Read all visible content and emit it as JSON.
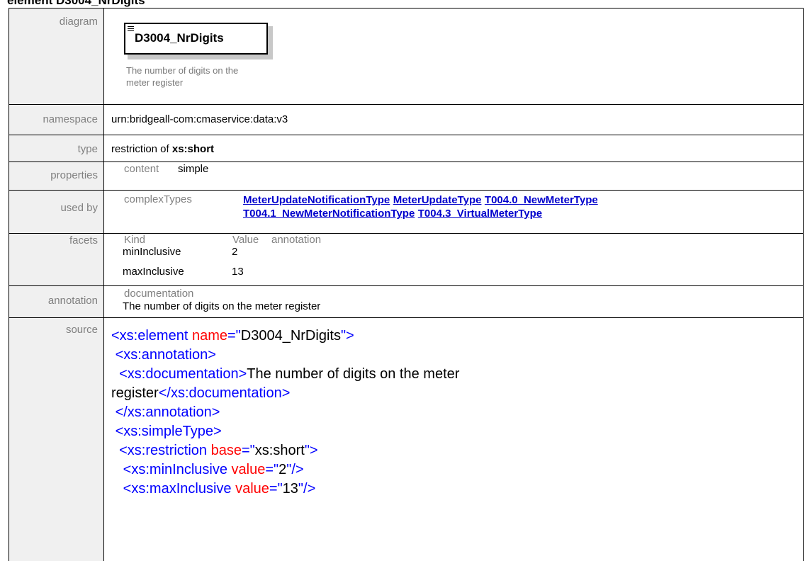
{
  "heading": "element D3004_NrDigits",
  "labels": {
    "diagram": "diagram",
    "namespace": "namespace",
    "type": "type",
    "properties": "properties",
    "used_by": "used by",
    "facets": "facets",
    "annotation": "annotation",
    "source": "source"
  },
  "diagram": {
    "element_name": "D3004_NrDigits",
    "doc_line1": "The number of digits on the",
    "doc_line2": "meter register"
  },
  "namespace": "urn:bridgeall-com:cmaservice:data:v3",
  "type": {
    "prefix": "restriction of ",
    "base": "xs:short"
  },
  "properties": {
    "key": "content",
    "value": "simple"
  },
  "used_by": {
    "category": "complexTypes",
    "links": [
      "MeterUpdateNotificationType",
      "MeterUpdateType",
      "T004.0_NewMeterType",
      "T004.1_NewMeterNotificationType",
      "T004.3_VirtualMeterType"
    ]
  },
  "facets": {
    "headers": [
      "Kind",
      "Value",
      "annotation"
    ],
    "rows": [
      {
        "kind": "minInclusive",
        "value": "2"
      },
      {
        "kind": "maxInclusive",
        "value": "13"
      }
    ]
  },
  "annotation": {
    "key": "documentation",
    "text": "The number of digits on the meter register"
  },
  "source": {
    "l1_tag": "<xs:element",
    "l1_attr": "name",
    "l1_eq": "=\"",
    "l1_val": "D3004_NrDigits",
    "l1_end": "\">",
    "l2": "<xs:annotation>",
    "l3_open": "<xs:documentation>",
    "l3_text": "The number of digits on the meter",
    "l4_text": "register",
    "l4_close": "</xs:documentation>",
    "l5": "</xs:annotation>",
    "l6": "<xs:simpleType>",
    "l7_tag": "<xs:restriction",
    "l7_attr": "base",
    "l7_eq": "=\"",
    "l7_val": "xs:short",
    "l7_end": "\">",
    "l8_tag": "<xs:minInclusive",
    "l8_attr": "value",
    "l8_eq": "=\"",
    "l8_val": "2",
    "l8_end": "\"/>",
    "l9_tag": "<xs:maxInclusive",
    "l9_attr": "value",
    "l9_eq": "=\"",
    "l9_val": "13",
    "l9_end": "\"/>"
  }
}
